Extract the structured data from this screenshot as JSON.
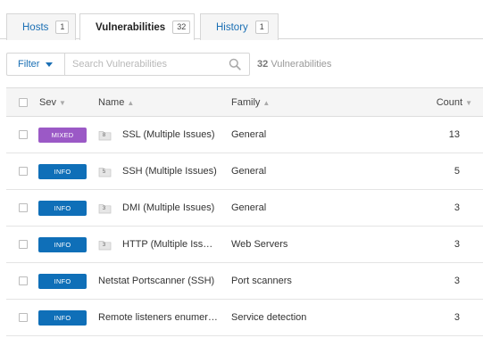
{
  "tabs": [
    {
      "label": "Hosts",
      "count": "1"
    },
    {
      "label": "Vulnerabilities",
      "count": "32"
    },
    {
      "label": "History",
      "count": "1"
    }
  ],
  "toolbar": {
    "filter_label": "Filter",
    "search_placeholder": "Search Vulnerabilities",
    "count_number": "32",
    "count_label": "Vulnerabilities"
  },
  "table": {
    "headers": {
      "sev": "Sev",
      "name": "Name",
      "family": "Family",
      "count": "Count"
    },
    "rows": [
      {
        "severity": "MIXED",
        "color": "#9b59c6",
        "group": "8",
        "name": "SSL (Multiple Issues)",
        "family": "General",
        "count": "13"
      },
      {
        "severity": "INFO",
        "color": "#0f6fb8",
        "group": "5",
        "name": "SSH (Multiple Issues)",
        "family": "General",
        "count": "5"
      },
      {
        "severity": "INFO",
        "color": "#0f6fb8",
        "group": "3",
        "name": "DMI (Multiple Issues)",
        "family": "General",
        "count": "3"
      },
      {
        "severity": "INFO",
        "color": "#0f6fb8",
        "group": "3",
        "name": "HTTP (Multiple Issues)",
        "family": "Web Servers",
        "count": "3"
      },
      {
        "severity": "INFO",
        "color": "#0f6fb8",
        "group": "",
        "name": "Netstat Portscanner (SSH)",
        "family": "Port scanners",
        "count": "3"
      },
      {
        "severity": "INFO",
        "color": "#0f6fb8",
        "group": "",
        "name": "Remote listeners enumeration",
        "family": "Service detection",
        "count": "3"
      }
    ]
  }
}
